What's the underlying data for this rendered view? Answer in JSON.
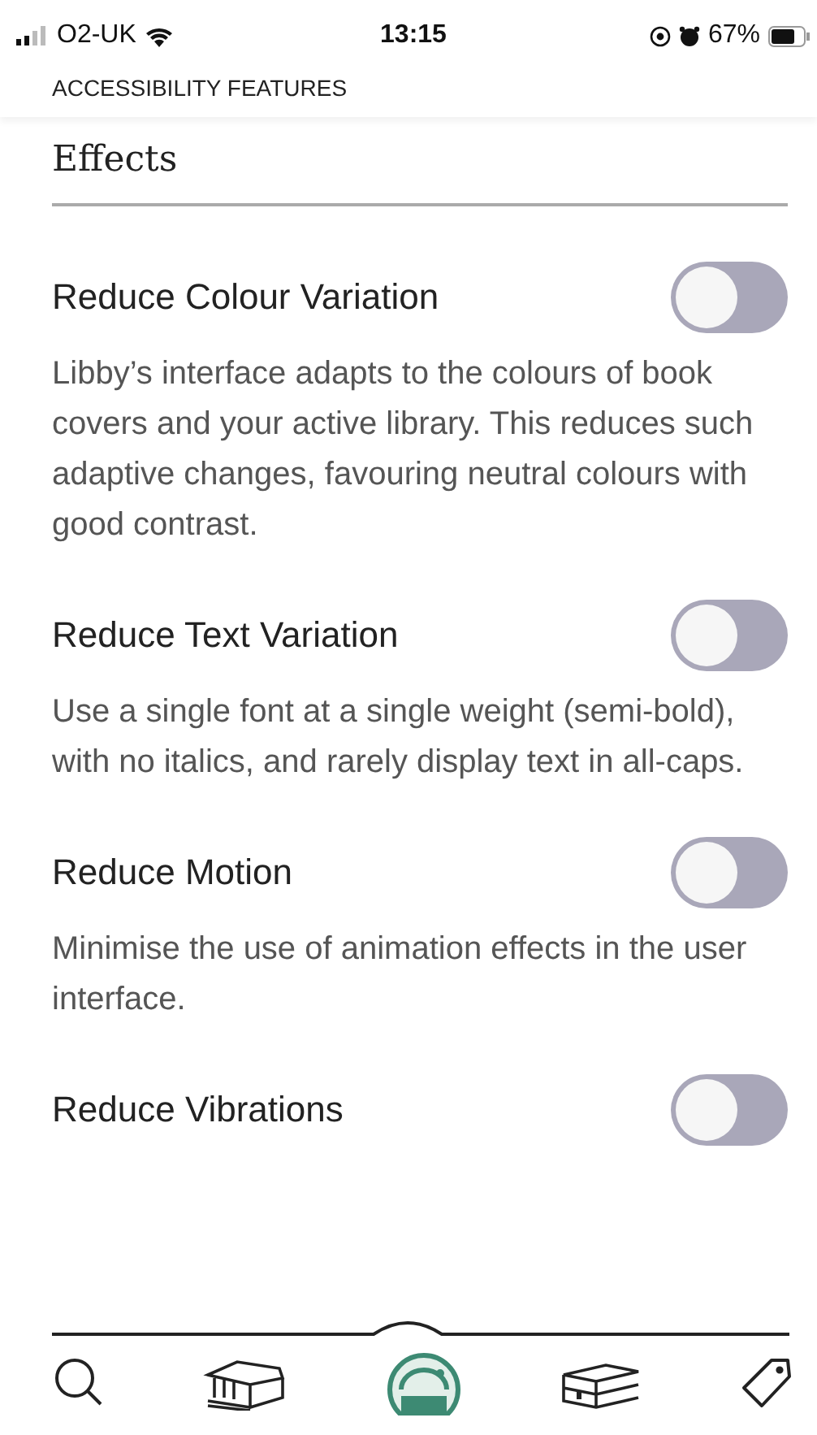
{
  "status_bar": {
    "carrier": "O2-UK",
    "time": "13:15",
    "battery": "67%"
  },
  "header": {
    "title": "ACCESSIBILITY FEATURES"
  },
  "section": {
    "title": "Effects"
  },
  "settings": [
    {
      "title": "Reduce Colour Variation",
      "description": "Libby’s interface adapts to the colours of book covers and your active library. This reduces such adaptive changes, favouring neutral colours with good contrast.",
      "on": false
    },
    {
      "title": "Reduce Text Variation",
      "description": "Use a single font at a single weight (semi-bold), with no italics, and rarely display text in all-caps.",
      "on": false
    },
    {
      "title": "Reduce Motion",
      "description": "Minimise the use of animation effects in the user interface.",
      "on": false
    },
    {
      "title": "Reduce Vibrations",
      "on": false
    }
  ],
  "nav": [
    {
      "kind": "search",
      "selected": false
    },
    {
      "kind": "library",
      "selected": false
    },
    {
      "kind": "shelf",
      "selected": true
    },
    {
      "kind": "books",
      "selected": false
    },
    {
      "kind": "tag",
      "selected": false
    }
  ]
}
